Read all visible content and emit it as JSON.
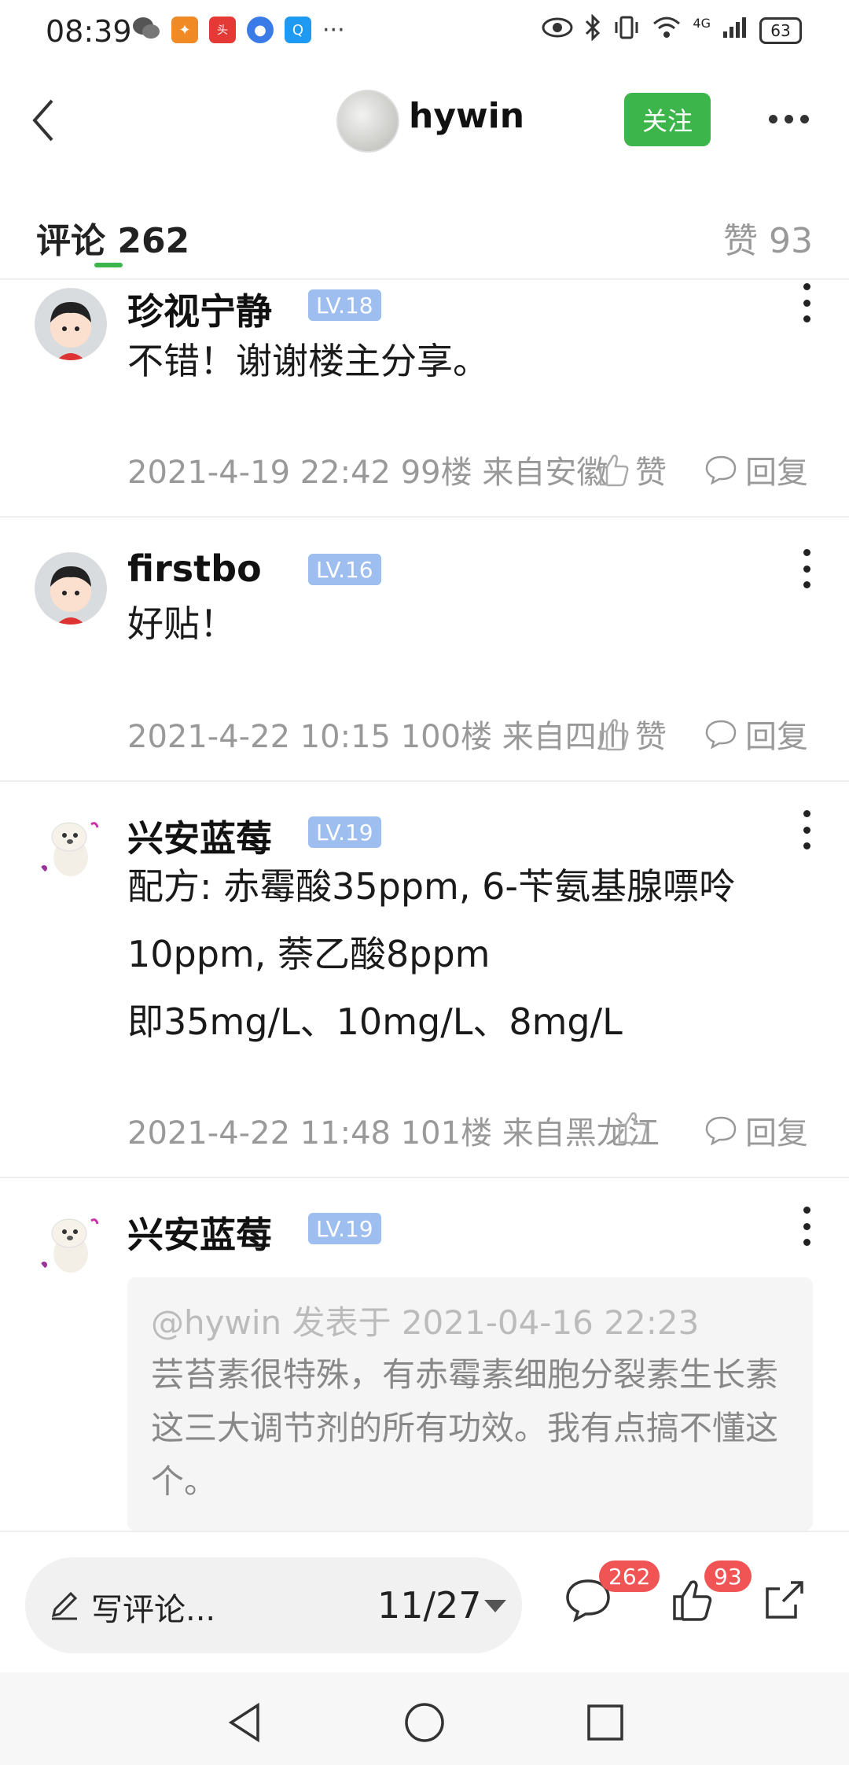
{
  "status_bar": {
    "time": "08:39",
    "dots": "···",
    "network": "4G",
    "battery": "63"
  },
  "header": {
    "username": "hywin",
    "follow_label": "关注"
  },
  "tabs": {
    "comments_label": "评论",
    "comments_count": "262",
    "likes_label": "赞",
    "likes_count": "93"
  },
  "comments": [
    {
      "name": "珍视宁静",
      "level": "LV.18",
      "text": "不错！谢谢楼主分享。",
      "meta": "2021-4-19 22:42  99楼  来自安徽",
      "like_label": "赞",
      "reply_label": "回复"
    },
    {
      "name": "firstbo",
      "level": "LV.16",
      "text": "好贴！",
      "meta": "2021-4-22 10:15  100楼  来自四川",
      "like_label": "赞",
      "reply_label": "回复"
    },
    {
      "name": "兴安蓝莓",
      "level": "LV.19",
      "text_lines": [
        "配方: 赤霉酸35ppm, 6-苄氨基腺嘌呤",
        "10ppm, 萘乙酸8ppm",
        "即35mg/L、10mg/L、8mg/L"
      ],
      "meta": "2021-4-22 11:48  101楼  来自黑龙江",
      "reply_label": "回复"
    },
    {
      "name": "兴安蓝莓",
      "level": "LV.19",
      "quote_head": "@hywin 发表于 2021-04-16 22:23",
      "quote_text": "芸苔素很特殊，有赤霉素细胞分裂素生长素这三大调节剂的所有功效。我有点搞不懂这个。"
    }
  ],
  "bottom_bar": {
    "input_placeholder": "写评论...",
    "page_indicator": "11/27",
    "comment_badge": "262",
    "like_badge": "93"
  }
}
